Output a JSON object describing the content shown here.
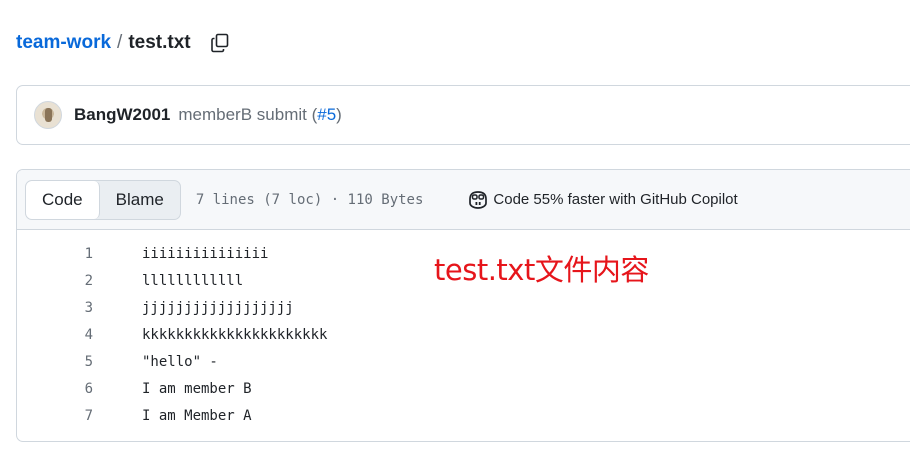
{
  "breadcrumb": {
    "repo": "team-work",
    "separator": "/",
    "file": "test.txt"
  },
  "commit": {
    "author": "BangW2001",
    "message": "memberB submit (",
    "pr": "#5",
    "message_end": ")"
  },
  "file_header": {
    "tabs": [
      {
        "label": "Code",
        "active": true
      },
      {
        "label": "Blame",
        "active": false
      }
    ],
    "info": "7 lines (7 loc) · 110 Bytes",
    "copilot_text": "Code 55% faster with GitHub Copilot"
  },
  "code": {
    "lines": [
      {
        "num": "1",
        "text": "iiiiiiiiiiiiiii"
      },
      {
        "num": "2",
        "text": "llllllllllll"
      },
      {
        "num": "3",
        "text": "jjjjjjjjjjjjjjjjjj"
      },
      {
        "num": "4",
        "text": "kkkkkkkkkkkkkkkkkkkkkk"
      },
      {
        "num": "5",
        "text": "\"hello\" -"
      },
      {
        "num": "6",
        "text": "I am member B"
      },
      {
        "num": "7",
        "text": "I am Member A"
      }
    ]
  },
  "annotation": "test.txt文件内容",
  "icons": {
    "copy": "copy-icon",
    "copilot": "copilot-icon",
    "avatar": "avatar"
  },
  "colors": {
    "link": "#0969da",
    "annotation": "#e6151b",
    "border": "#d0d7de",
    "header_bg": "#f6f8fa"
  }
}
